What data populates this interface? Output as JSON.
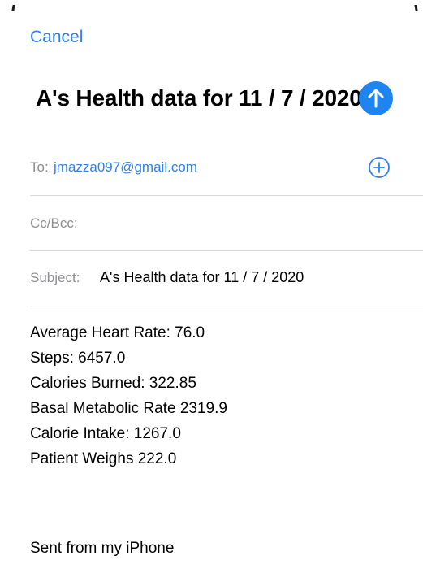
{
  "compose": {
    "cancel_label": "Cancel",
    "title": "A's Health data for 11 / 7 / 2020",
    "send_icon": "arrow-up-icon",
    "accent_color": "#1d84f0"
  },
  "fields": {
    "to_label": "To:",
    "to_value": "jmazza097@gmail.com",
    "add_icon": "plus-circle-icon",
    "cc_label": "Cc/Bcc:",
    "subject_label": "Subject:",
    "subject_value": "A's Health data for 11 / 7 / 2020"
  },
  "body": {
    "lines": [
      "Average Heart Rate: 76.0",
      "Steps: 6457.0",
      "Calories Burned: 322.85",
      "Basal Metabolic Rate 2319.9",
      "Calorie Intake: 1267.0",
      "Patient Weighs 222.0"
    ],
    "signature": "Sent from my iPhone"
  }
}
